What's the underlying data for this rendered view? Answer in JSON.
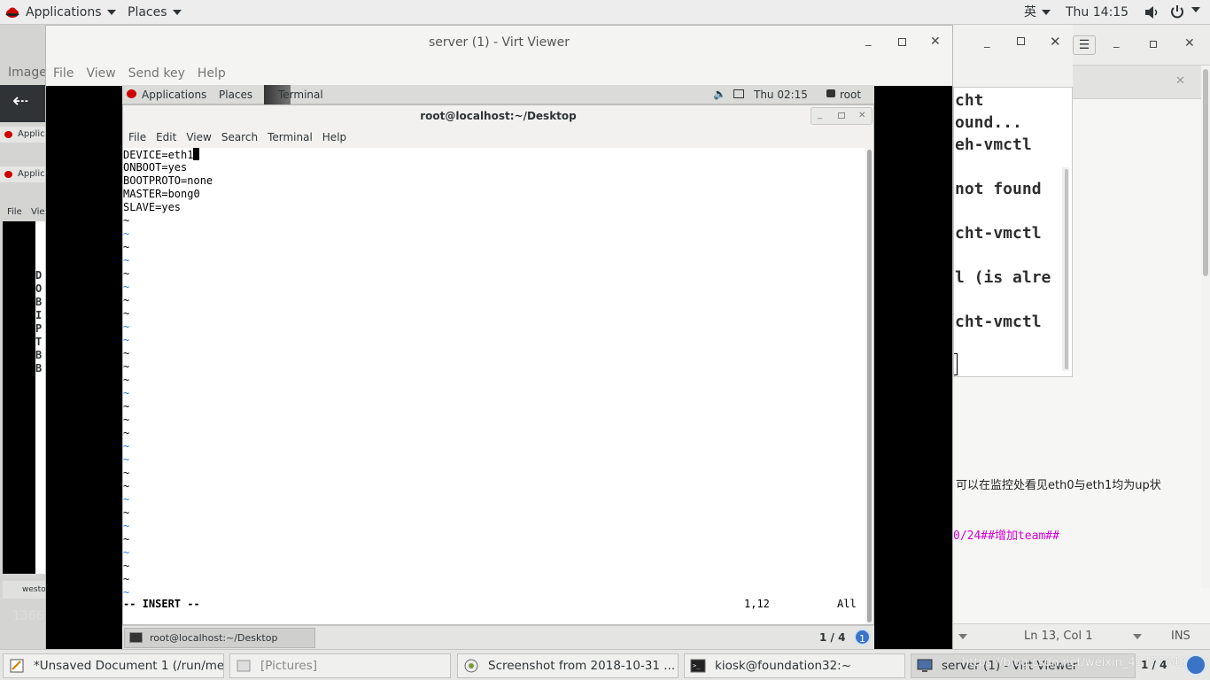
{
  "host_topbar": {
    "applications": "Applications",
    "places": "Places",
    "input_method": "英",
    "clock": "Thu 14:15"
  },
  "viewer": {
    "title": "server (1) - Virt Viewer",
    "menu": [
      "File",
      "View",
      "Send key",
      "Help"
    ]
  },
  "guest_topbar": {
    "applications": "Applications",
    "places": "Places",
    "task": "Terminal",
    "clock": "Thu 02:15",
    "user": "root"
  },
  "guest_terminal": {
    "title": "root@localhost:~/Desktop",
    "menu": [
      "File",
      "Edit",
      "View",
      "Search",
      "Terminal",
      "Help"
    ]
  },
  "vim": {
    "lines": [
      "DEVICE=eth1",
      "ONBOOT=yes",
      "BOOTPROTO=none",
      "MASTER=bong0",
      "SLAVE=yes"
    ],
    "tilde": "~",
    "mode": "-- INSERT --",
    "position": "1,12",
    "scroll": "All"
  },
  "guest_taskbar": {
    "item": "root@localhost:~/Desktop",
    "pager": "1 / 4",
    "notify": "1"
  },
  "left_window": {
    "image": "Image",
    "applic": "Applic",
    "applic2": "Applic",
    "file": "File",
    "view": "Vie",
    "letters": [
      "D",
      "O",
      "B",
      "I",
      "P",
      "T",
      "B",
      "B"
    ],
    "weston": "westo",
    "size": "1366"
  },
  "right_terminal": {
    "lines": [
      "cht",
      "ound...",
      "eh-vmctl",
      "",
      "not found",
      "",
      "cht-vmctl",
      "",
      "l (is alre",
      "",
      "cht-vmctl"
    ]
  },
  "right_doc": {
    "note": "可以在监控处看见eth0与eth1均为up状",
    "command": "0/24##增加team##",
    "status": "Ln 13, Col 1",
    "ins": "INS"
  },
  "host_taskbar": {
    "items": [
      "*Unsaved Document 1 (/run/me...",
      "[Pictures]",
      "Screenshot from 2018-10-31 ...",
      "kiosk@foundation32:~",
      "server (1) - Virt Viewer"
    ],
    "watermark": "https://blog.csdn.net/weixin_41476840",
    "pager": "1 / 4"
  }
}
